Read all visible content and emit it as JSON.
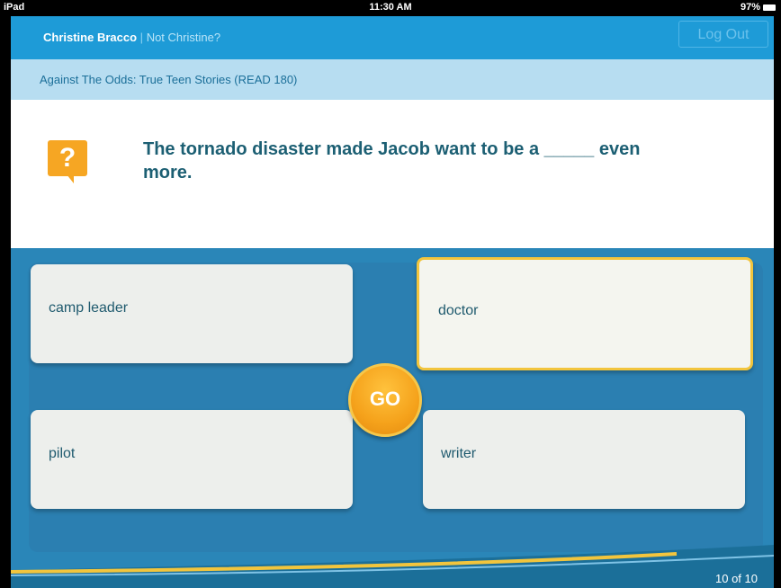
{
  "status_bar": {
    "device": "iPad",
    "time": "11:30 AM",
    "battery": "97%"
  },
  "header": {
    "user_name": "Christine Bracco",
    "separator": "|",
    "not_user": "Not Christine?",
    "logout_label": "Log Out"
  },
  "book": {
    "title": "Against The Odds: True Teen Stories (READ 180)"
  },
  "question": {
    "icon": "question-icon",
    "text": "The tornado disaster made Jacob want to be a _____ even more."
  },
  "answers": [
    {
      "label": "camp leader",
      "selected": false
    },
    {
      "label": "doctor",
      "selected": true
    },
    {
      "label": "pilot",
      "selected": false
    },
    {
      "label": "writer",
      "selected": false
    }
  ],
  "go_label": "GO",
  "progress": {
    "label": "10 of 10",
    "current": 10,
    "total": 10
  },
  "colors": {
    "header": "#1e9bd7",
    "subheader": "#b7ddf1",
    "question_text": "#1c5f73",
    "accent_orange": "#f6a623",
    "selected_border": "#f2c53d",
    "answers_bg": "#2a86b8"
  }
}
